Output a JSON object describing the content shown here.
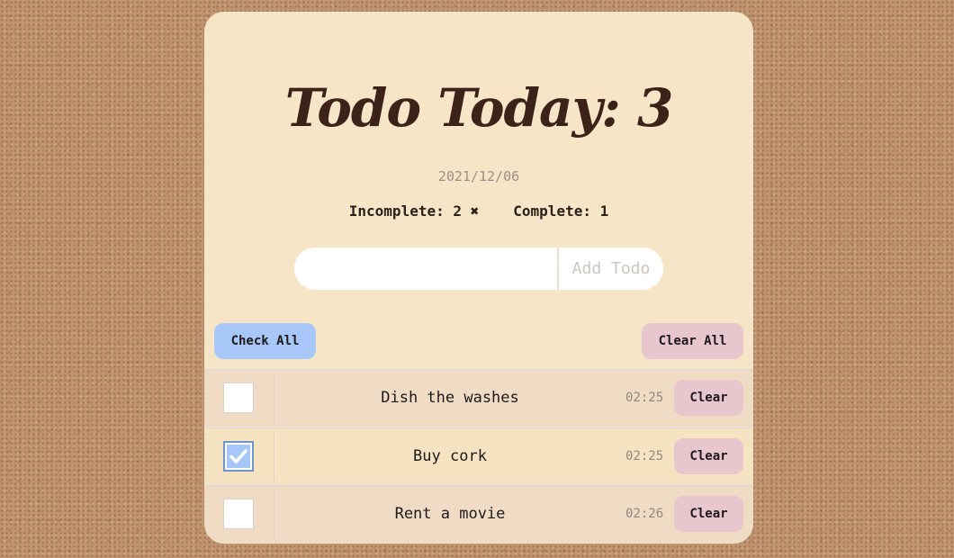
{
  "header": {
    "title": "Todo Today: 3",
    "date": "2021/12/06",
    "incomplete_label": "Incomplete: 2 ✖",
    "complete_label": "Complete: 1"
  },
  "add": {
    "input_value": "",
    "input_placeholder": "",
    "button_label": "Add Todo"
  },
  "toolbar": {
    "check_all_label": "Check All",
    "clear_all_label": "Clear All"
  },
  "todos": [
    {
      "text": "Dish the washes",
      "time": "02:25",
      "checked": false,
      "clear_label": "Clear"
    },
    {
      "text": "Buy cork",
      "time": "02:25",
      "checked": true,
      "clear_label": "Clear"
    },
    {
      "text": "Rent a movie",
      "time": "02:26",
      "checked": false,
      "clear_label": "Clear"
    }
  ],
  "colors": {
    "background": "#c09470",
    "card": "#f6e5c6",
    "title": "#3d2219",
    "check_all": "#a6c7f7",
    "clear": "#e8c6ce"
  }
}
